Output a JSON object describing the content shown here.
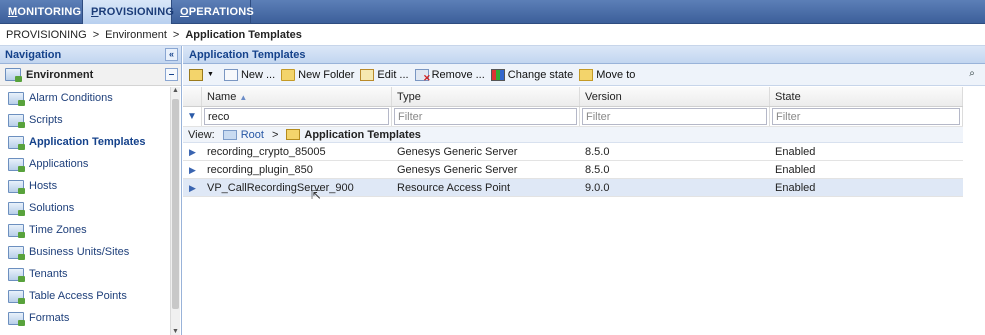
{
  "top_tabs": [
    {
      "label": "MONITORING",
      "underline": "M",
      "rest": "ONITORING"
    },
    {
      "label": "PROVISIONING",
      "underline": "P",
      "rest": "ROVISIONING"
    },
    {
      "label": "OPERATIONS",
      "underline": "O",
      "rest": "PERATIONS"
    }
  ],
  "breadcrumb": {
    "items": [
      "PROVISIONING",
      "Environment"
    ],
    "separator": ">",
    "current": "Application Templates"
  },
  "navigation": {
    "title": "Navigation",
    "collapse_glyph": "«",
    "root": "Environment",
    "root_toggle": "–",
    "items": [
      "Alarm Conditions",
      "Scripts",
      "Application Templates",
      "Applications",
      "Hosts",
      "Solutions",
      "Time Zones",
      "Business Units/Sites",
      "Tenants",
      "Table Access Points",
      "Formats"
    ],
    "active_index": 2
  },
  "main": {
    "title": "Application Templates",
    "toolbar": {
      "new_label": "New ...",
      "new_folder_label": "New Folder",
      "edit_label": "Edit ...",
      "remove_label": "Remove ...",
      "change_state_label": "Change state",
      "move_to_label": "Move to"
    },
    "columns": [
      "Name",
      "Type",
      "Version",
      "State"
    ],
    "filter": {
      "name_value": "reco",
      "name_placeholder": "Filter",
      "type_placeholder": "Filter",
      "version_placeholder": "Filter",
      "state_placeholder": "Filter"
    },
    "view": {
      "label": "View:",
      "root": "Root",
      "separator": ">",
      "folder": "Application Templates"
    },
    "rows": [
      {
        "name": "recording_crypto_85005",
        "type": "Genesys Generic Server",
        "version": "8.5.0",
        "state": "Enabled"
      },
      {
        "name": "recording_plugin_850",
        "type": "Genesys Generic Server",
        "version": "8.5.0",
        "state": "Enabled"
      },
      {
        "name": "VP_CallRecordingServer_900",
        "type": "Resource Access Point",
        "version": "9.0.0",
        "state": "Enabled"
      }
    ],
    "selected_row": 2
  },
  "colors": {
    "header_blue": "#15428b",
    "topbar": "#3c5f9a",
    "selected_row": "#dfe8f6"
  }
}
